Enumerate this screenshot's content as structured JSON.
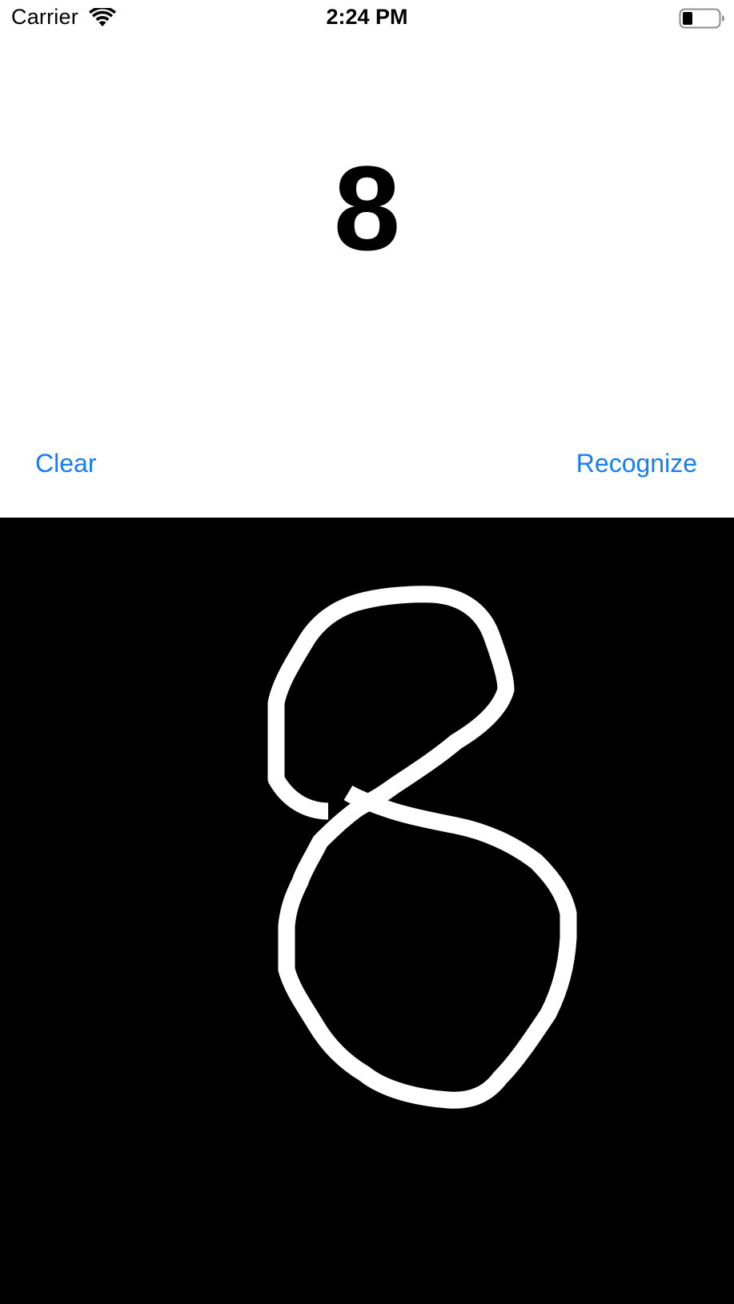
{
  "status_bar": {
    "carrier": "Carrier",
    "time": "2:24 PM",
    "icons": [
      "wifi-icon",
      "battery-icon"
    ]
  },
  "result": {
    "digit": "8"
  },
  "actions": {
    "clear_label": "Clear",
    "recognize_label": "Recognize"
  },
  "canvas": {
    "background_color": "#000000",
    "stroke_color": "#ffffff"
  },
  "colors": {
    "accent": "#1a7cf5",
    "text": "#000000",
    "background": "#ffffff"
  }
}
